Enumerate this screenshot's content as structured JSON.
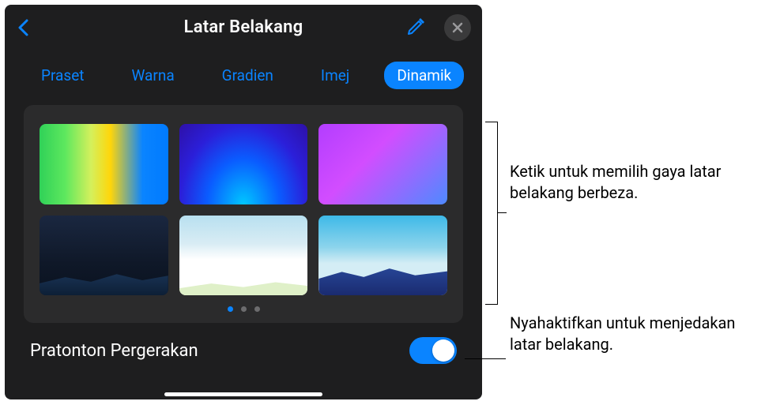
{
  "header": {
    "title": "Latar Belakang"
  },
  "tabs": {
    "items": [
      {
        "label": "Praset"
      },
      {
        "label": "Warna"
      },
      {
        "label": "Gradien"
      },
      {
        "label": "Imej"
      },
      {
        "label": "Dinamik"
      }
    ],
    "active_index": 4
  },
  "pagination": {
    "count": 3,
    "active_index": 0
  },
  "preview": {
    "label": "Pratonton Pergerakan",
    "enabled": true
  },
  "callouts": {
    "tabs": "Ketik untuk memilih gaya latar belakang berbeza.",
    "toggle": "Nyahaktifkan untuk menjedakan latar belakang."
  },
  "colors": {
    "accent": "#0a84ff",
    "panel_bg": "#1e1e1f",
    "content_bg": "#2b2b2c"
  }
}
